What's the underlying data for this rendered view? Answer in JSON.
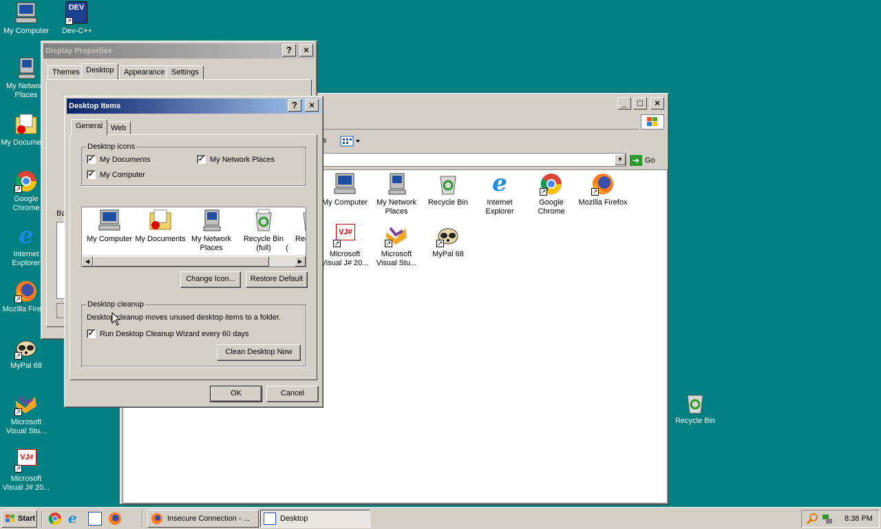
{
  "desktop": {
    "icons": [
      {
        "label": "My Computer",
        "icon": "my-computer-icon"
      },
      {
        "label": "Dev-C++",
        "icon": "devcpp-icon",
        "badge": "DEV"
      },
      {
        "label": "My Network Places",
        "icon": "network-places-icon"
      },
      {
        "label": "My Documents",
        "icon": "my-documents-icon"
      },
      {
        "label": "Google Chrome",
        "icon": "chrome-icon"
      },
      {
        "label": "Internet Explorer",
        "icon": "ie-icon"
      },
      {
        "label": "Mozilla Firef...",
        "icon": "firefox-icon"
      },
      {
        "label": "MyPal 68",
        "icon": "mypal-icon"
      },
      {
        "label": "Microsoft Visual Stu...",
        "icon": "visual-studio-icon"
      },
      {
        "label": "Microsoft Visual J# 20...",
        "icon": "visual-j-icon",
        "badge": "VJ#"
      },
      {
        "label": "Recycle Bin",
        "icon": "recycle-bin-icon"
      }
    ]
  },
  "display_properties": {
    "title": "Display Properties",
    "tabs": [
      "Themes",
      "Desktop",
      "Appearance",
      "Settings"
    ],
    "background_label": "Ba"
  },
  "explorer": {
    "toolbar_fragment": "s",
    "go_label": "Go",
    "items": [
      {
        "label": "My Computer",
        "icon": "my-computer-icon"
      },
      {
        "label": "My Network Places",
        "icon": "network-places-icon"
      },
      {
        "label": "Recycle Bin",
        "icon": "recycle-bin-icon"
      },
      {
        "label": "Internet Explorer",
        "icon": "ie-icon"
      },
      {
        "label": "Google Chrome",
        "icon": "chrome-icon"
      },
      {
        "label": "Mozilla Firefox",
        "icon": "firefox-icon"
      },
      {
        "label": "Microsoft Visual J# 20...",
        "icon": "visual-j-icon",
        "badge": "VJ#"
      },
      {
        "label": "Microsoft Visual Stu...",
        "icon": "visual-studio-icon"
      },
      {
        "label": "MyPal 68",
        "icon": "mypal-icon"
      }
    ]
  },
  "desktop_items": {
    "title": "Desktop Items",
    "tabs": [
      "General",
      "Web"
    ],
    "desktop_icons_group": "Desktop icons",
    "checkboxes": [
      {
        "label": "My Documents",
        "checked": true
      },
      {
        "label": "My Network Places",
        "checked": true
      },
      {
        "label": "My Computer",
        "checked": true
      }
    ],
    "preview_items": [
      {
        "label": "My Computer",
        "icon": "my-computer-icon"
      },
      {
        "label": "My Documents",
        "icon": "my-documents-icon"
      },
      {
        "label": "My Network Places",
        "icon": "network-places-icon"
      },
      {
        "label": "Recycle Bin (full)",
        "icon": "recycle-bin-full-icon"
      },
      {
        "label": "Rec (",
        "icon": "recycle-bin-empty-icon"
      }
    ],
    "change_icon_label": "Change Icon...",
    "restore_default_label": "Restore Default",
    "cleanup_group": "Desktop cleanup",
    "cleanup_text": "Desktop cleanup moves unused desktop items to a folder.",
    "cleanup_checkbox": "Run Desktop Cleanup Wizard every 60 days",
    "clean_now_label": "Clean Desktop Now",
    "ok_label": "OK",
    "cancel_label": "Cancel"
  },
  "taskbar": {
    "start_label": "Start",
    "tasks": [
      {
        "label": "Insecure Connection - ...",
        "icon": "firefox-icon"
      },
      {
        "label": "Desktop",
        "icon": "explorer-window-icon"
      }
    ],
    "time": "8:38 PM"
  },
  "colors": {
    "desktop": "#008080",
    "title_active": "#0a246a",
    "face": "#d4d0c8"
  }
}
